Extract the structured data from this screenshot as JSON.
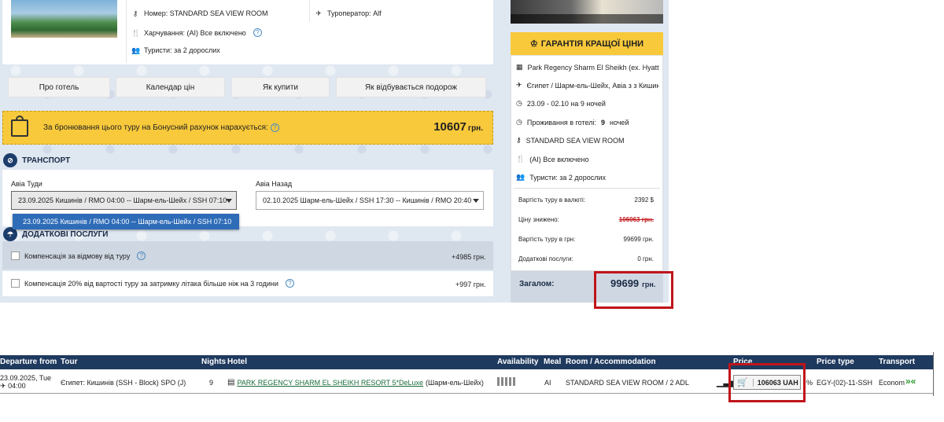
{
  "hotel_info": {
    "room": "Номер: STANDARD SEA VIEW ROOM",
    "meal": "Харчування: (AI) Все включено",
    "tourists": "Туристи: за 2 дорослих",
    "operator": "Туроператор: Alf"
  },
  "tabs": [
    "Про готель",
    "Календар цін",
    "Як купити",
    "Як відбувається подорож"
  ],
  "bonus": {
    "text": "За бронювання цього туру на Бонусний рахунок нарахується:",
    "amount": "10607",
    "currency": "грн."
  },
  "transport": {
    "title": "ТРАНСПОРТ",
    "to_label": "Авіа Туди",
    "back_label": "Авіа Назад",
    "to_value": "23.09.2025 Кишинів / RMO 04:00 -- Шарм-ель-Шейх / SSH 07:10",
    "back_value": "02.10.2025 Шарм-ель-Шейх / SSH 17:30 -- Кишинів / RMO 20:40",
    "dropdown_option": "23.09.2025 Кишинів / RMO 04:00 -- Шарм-ель-Шейх / SSH 07:10"
  },
  "extras": {
    "title": "ДОДАТКОВІ ПОСЛУГИ",
    "items": [
      {
        "label": "Компенсація за відмову від туру",
        "price": "+4985 грн."
      },
      {
        "label": "Компенсація 20% від вартості туру за затримку літака більше ніж на 3 години",
        "price": "+997 грн."
      }
    ]
  },
  "guarantee": {
    "title": "ГАРАНТІЯ КРАЩОЇ ЦІНИ"
  },
  "summary": {
    "hotel": "Park Regency Sharm El Sheikh (ex. Hyatt Regency)",
    "route": "Єгипет / Шарм-ель-Шейх, Авіа з з Кишинів",
    "dates": "23.09 - 02.10 на 9 ночей",
    "stay_label": "Проживання в готелі:",
    "stay_nights": "9",
    "stay_unit": "ночей",
    "room": "STANDARD SEA VIEW ROOM",
    "meal": "(AI) Все включено",
    "tourists": "Туристи: за 2 дорослих"
  },
  "prices": [
    {
      "label": "Вартість туру в валюті:",
      "value": "2392 $"
    },
    {
      "label": "Ціну знижено:",
      "value": "106063 грн."
    },
    {
      "label": "Вартість туру в грн:",
      "value": "99699 грн."
    },
    {
      "label": "Додаткові послуги:",
      "value": "0 грн."
    }
  ],
  "total": {
    "label": "Загалом:",
    "value": "99699",
    "currency": "грн."
  },
  "table": {
    "headers": [
      "Departure from",
      "Tour",
      "Nights",
      "Hotel",
      "Availability",
      "Meal",
      "Room / Accommodation",
      "Price",
      "Price type",
      "Transport"
    ],
    "row": {
      "departure_date": "23.09.2025, Tue",
      "departure_time": "04:00",
      "tour": "Єгипет: Кишинів (SSH - Block) SPO (J)",
      "nights": "9",
      "hotel": "PARK REGENCY SHARM EL SHEIKH RESORT 5*DeLuxe",
      "hotel_city": "(Шарм-ель-Шейх)",
      "meal": "AI",
      "room": "STANDARD SEA VIEW ROOM / 2 ADL",
      "price": "106063 UAH",
      "price_type": "EGY-(02)-11-SSH",
      "transport": "Econom"
    }
  },
  "colors": {
    "accent": "#f8c93b",
    "navy": "#1c3d6b",
    "highlight": "#c0141b",
    "header_bg": "#1f3a5f"
  }
}
